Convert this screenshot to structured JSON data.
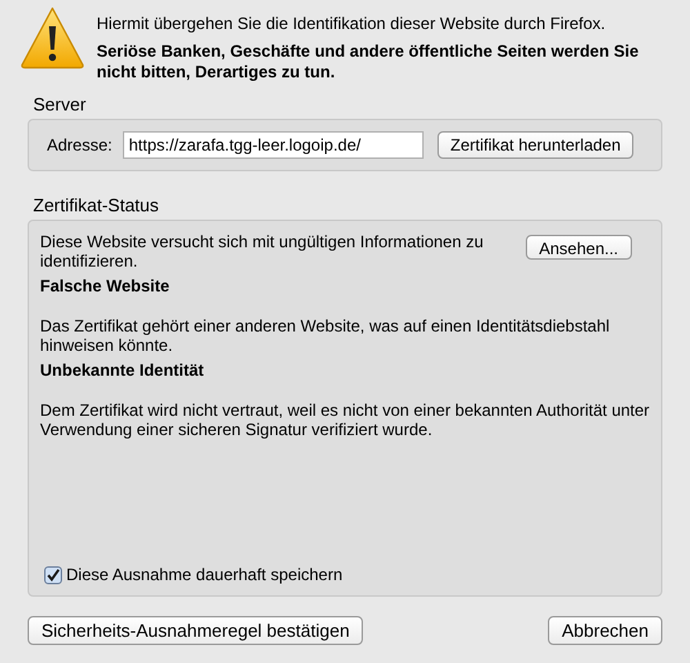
{
  "header": {
    "message": "Hiermit übergehen Sie die Identifikation dieser Website durch Firefox.",
    "warning": "Seriöse Banken, Geschäfte und andere öffentliche Seiten werden Sie nicht bitten, Derartiges zu tun."
  },
  "server": {
    "title": "Server",
    "address_label": "Adresse:",
    "address_value": "https://zarafa.tgg-leer.logoip.de/",
    "download_button": "Zertifikat herunterladen"
  },
  "certificate_status": {
    "title": "Zertifikat-Status",
    "view_button": "Ansehen...",
    "items": [
      {
        "kind": "text",
        "text": "Diese Website versucht sich mit ungültigen Informationen zu identifizieren."
      },
      {
        "kind": "heading",
        "text": "Falsche Website"
      },
      {
        "kind": "text",
        "text": "Das Zertifikat gehört einer anderen Website, was auf einen Identitätsdiebstahl hinweisen könnte."
      },
      {
        "kind": "heading",
        "text": "Unbekannte Identität"
      },
      {
        "kind": "text",
        "text": "Dem Zertifikat wird nicht vertraut, weil es nicht von einer bekannten Authorität unter Verwendung einer sicheren Signatur verifiziert wurde."
      }
    ],
    "permanent": {
      "label": "Diese Ausnahme dauerhaft speichern",
      "checked": true
    }
  },
  "buttons": {
    "confirm": "Sicherheits-Ausnahmeregel bestätigen",
    "cancel": "Abbrechen"
  }
}
